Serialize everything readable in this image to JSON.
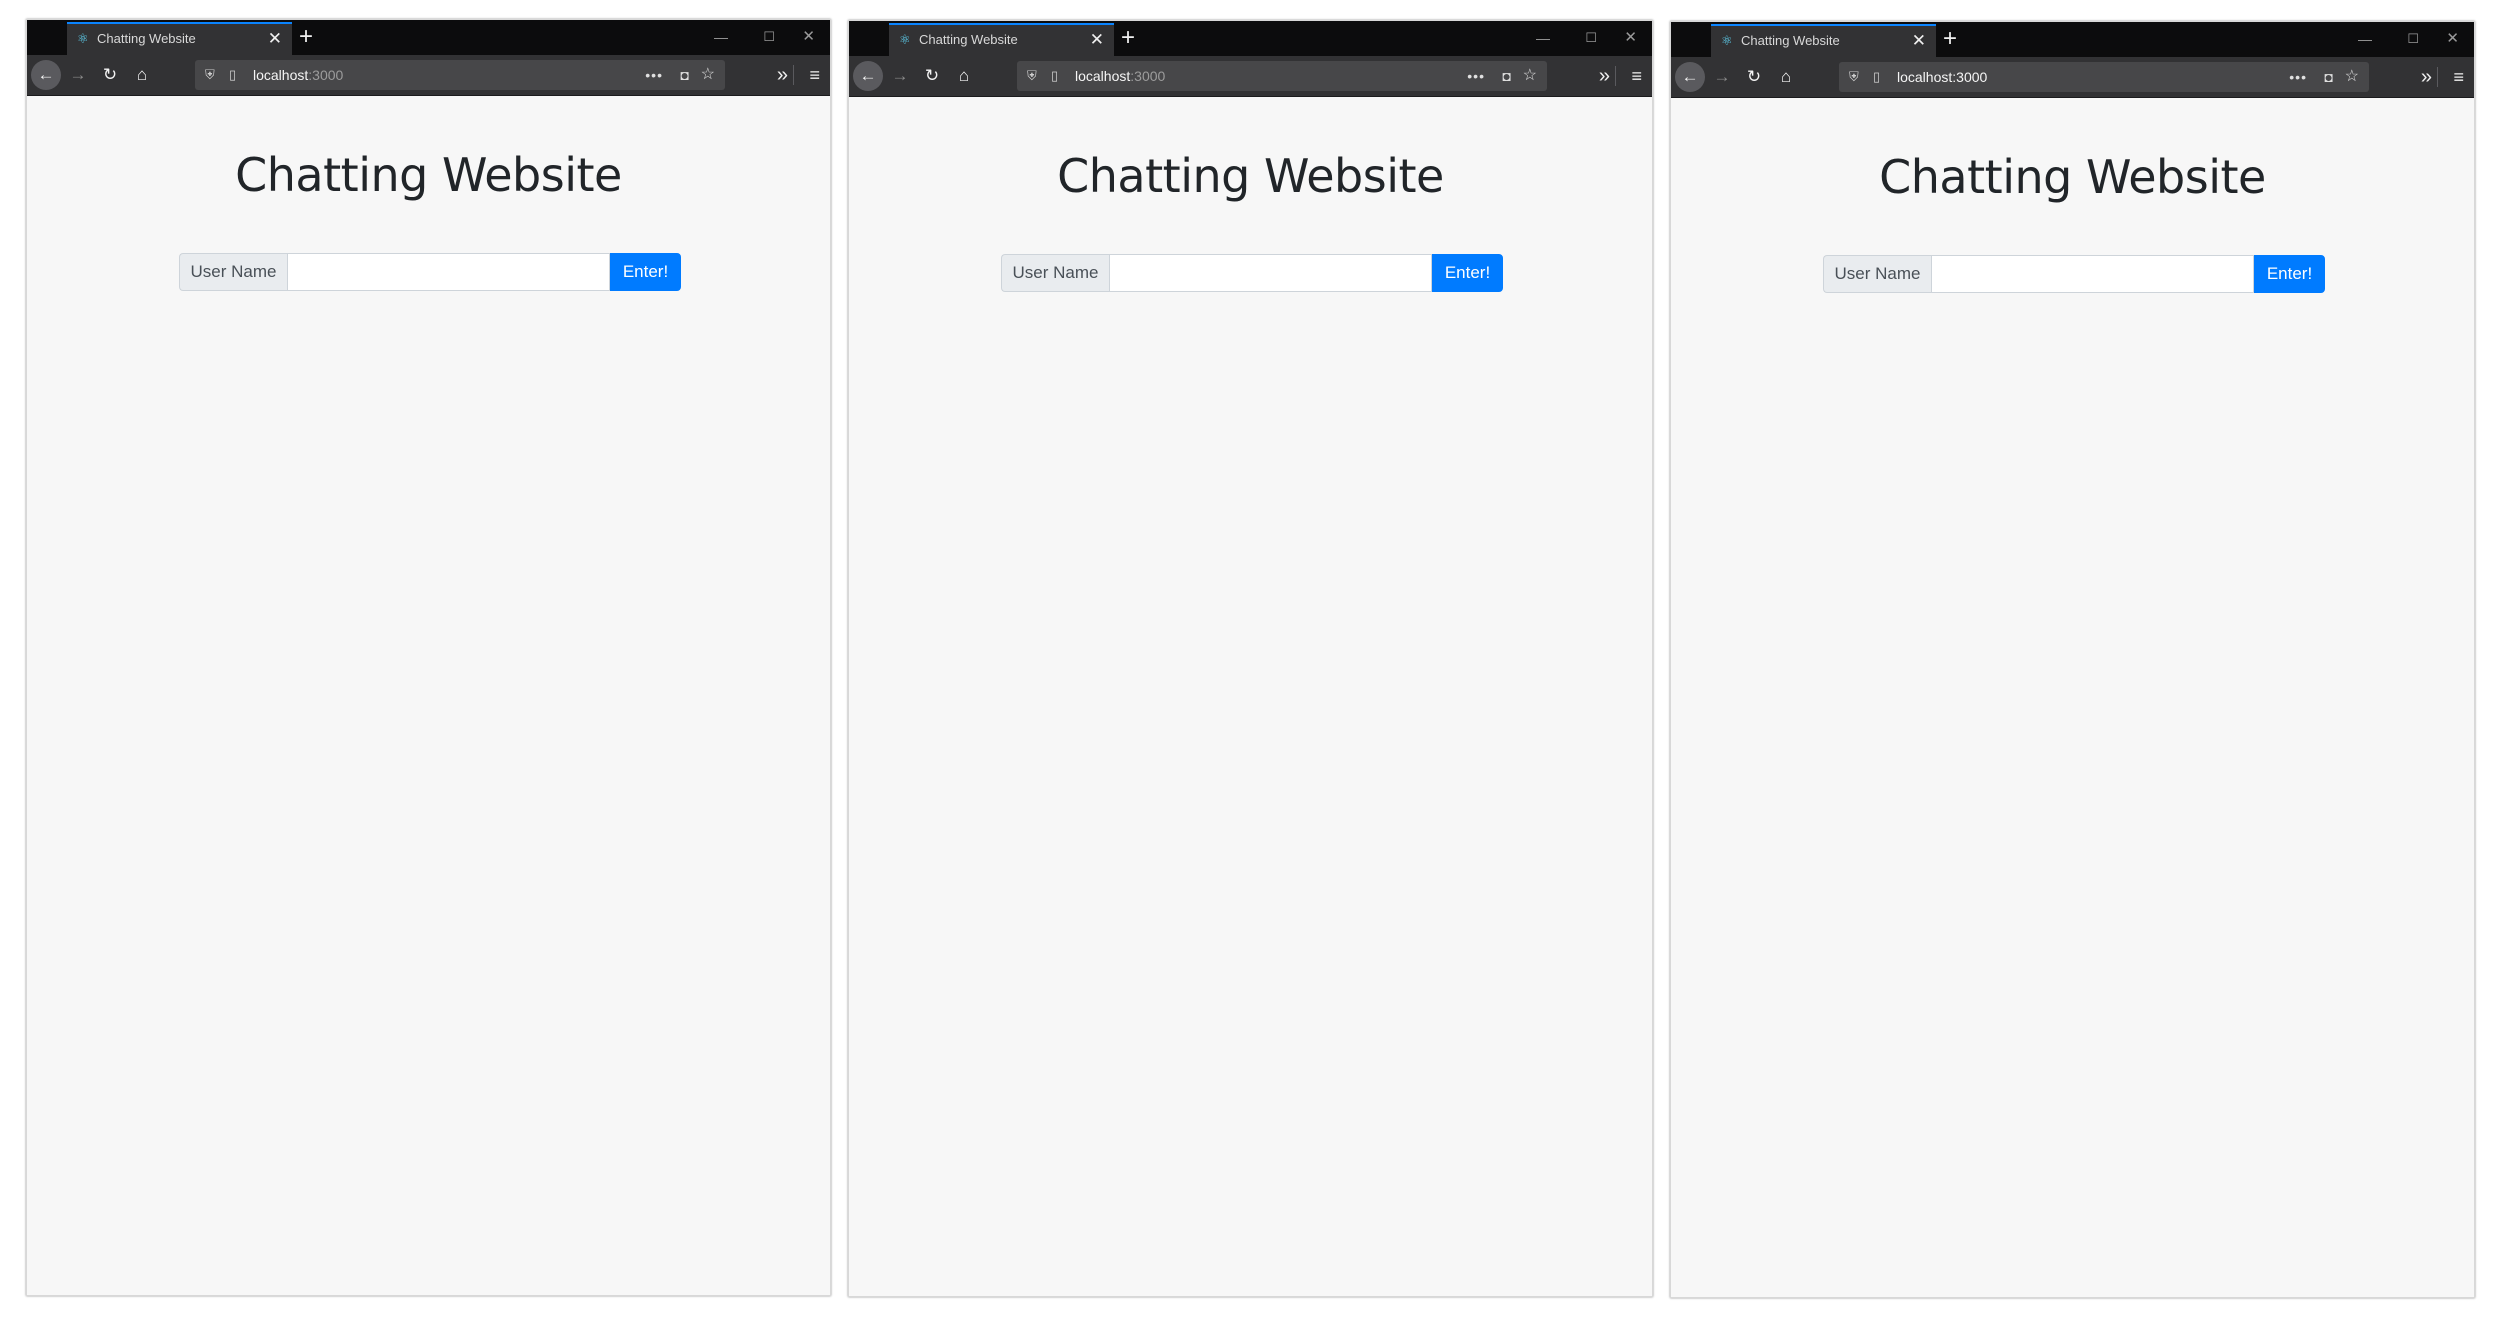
{
  "windows": [
    {
      "tab": {
        "title": "Chatting Website",
        "favicon": "react-icon",
        "close": "✕"
      },
      "new_tab": "+",
      "window_controls": {
        "minimize": "—",
        "maximize": "☐",
        "close": "✕"
      },
      "toolbar": {
        "back": "←",
        "forward": "→",
        "reload": "↻",
        "home": "⌂",
        "overflow": "»",
        "menu": "≡"
      },
      "url": {
        "shield": "⛨",
        "page": "▯",
        "host": "localhost",
        "port": ":3000",
        "more": "•••",
        "pocket": "◘",
        "star": "☆"
      },
      "page": {
        "heading": "Chatting Website",
        "label": "User Name",
        "input_value": "",
        "input_placeholder": "",
        "button": "Enter!"
      }
    },
    {
      "tab": {
        "title": "Chatting Website",
        "favicon": "react-icon",
        "close": "✕"
      },
      "new_tab": "+",
      "window_controls": {
        "minimize": "—",
        "maximize": "☐",
        "close": "✕"
      },
      "toolbar": {
        "back": "←",
        "forward": "→",
        "reload": "↻",
        "home": "⌂",
        "overflow": "»",
        "menu": "≡"
      },
      "url": {
        "shield": "⛨",
        "page": "▯",
        "host": "localhost",
        "port": ":3000",
        "more": "•••",
        "pocket": "◘",
        "star": "☆"
      },
      "page": {
        "heading": "Chatting Website",
        "label": "User Name",
        "input_value": "",
        "input_placeholder": "",
        "button": "Enter!"
      }
    },
    {
      "tab": {
        "title": "Chatting Website",
        "favicon": "react-icon",
        "close": "✕"
      },
      "new_tab": "+",
      "window_controls": {
        "minimize": "—",
        "maximize": "☐",
        "close": "✕"
      },
      "toolbar": {
        "back": "←",
        "forward": "→",
        "reload": "↻",
        "home": "⌂",
        "overflow": "»",
        "menu": "≡"
      },
      "url": {
        "shield": "⛨",
        "page": "▯",
        "host": "localhost",
        "port": ":3000",
        "more": "•••",
        "pocket": "◘",
        "star": "☆"
      },
      "page": {
        "heading": "Chatting Website",
        "label": "User Name",
        "input_value": "",
        "input_placeholder": "",
        "button": "Enter!"
      }
    }
  ],
  "colors": {
    "accent": "#007bff",
    "tab_highlight": "#0a84ff",
    "titlebar": "#0c0c0d",
    "toolbar": "#323234",
    "page_bg": "#f7f7f7"
  }
}
